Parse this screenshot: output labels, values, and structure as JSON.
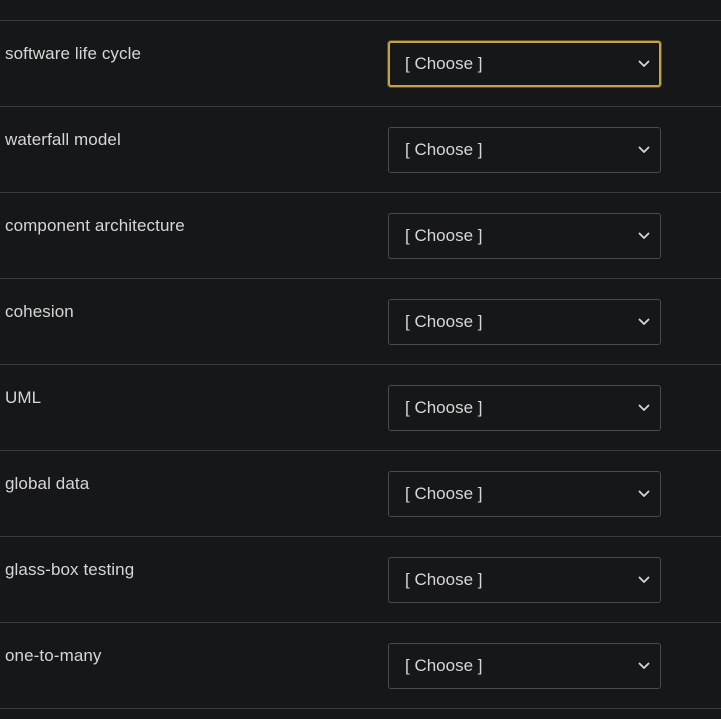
{
  "matching": {
    "rows": [
      {
        "term": "software life cycle",
        "selected": "[ Choose ]",
        "focused": true
      },
      {
        "term": "waterfall model",
        "selected": "[ Choose ]",
        "focused": false
      },
      {
        "term": "component architecture",
        "selected": "[ Choose ]",
        "focused": false
      },
      {
        "term": "cohesion",
        "selected": "[ Choose ]",
        "focused": false
      },
      {
        "term": "UML",
        "selected": "[ Choose ]",
        "focused": false
      },
      {
        "term": "global data",
        "selected": "[ Choose ]",
        "focused": false
      },
      {
        "term": "glass-box testing",
        "selected": "[ Choose ]",
        "focused": false
      },
      {
        "term": "one-to-many",
        "selected": "[ Choose ]",
        "focused": false
      }
    ]
  },
  "colors": {
    "background": "#161718",
    "focus_border": "#c8a24a",
    "divider": "#3a3b3d"
  },
  "icons": {
    "dropdown": "chevron-down-icon"
  }
}
